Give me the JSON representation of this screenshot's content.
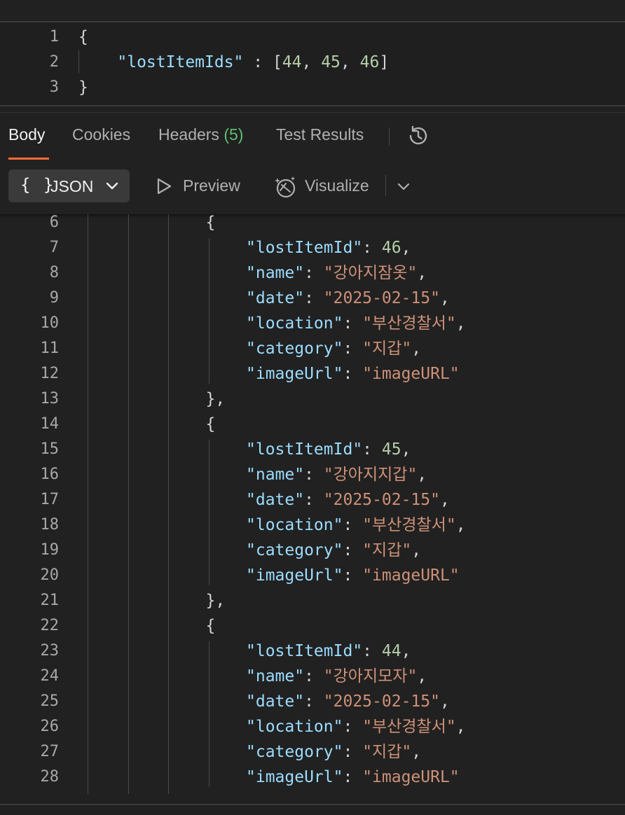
{
  "request": {
    "lines": [
      {
        "n": "1",
        "tokens": [
          {
            "t": "{",
            "c": "brace"
          }
        ]
      },
      {
        "n": "2",
        "tokens": [
          {
            "t": "    ",
            "c": "punc"
          },
          {
            "t": "\"lostItemIds\"",
            "c": "key"
          },
          {
            "t": " : [",
            "c": "punc"
          },
          {
            "t": "44",
            "c": "num"
          },
          {
            "t": ", ",
            "c": "punc"
          },
          {
            "t": "45",
            "c": "num"
          },
          {
            "t": ", ",
            "c": "punc"
          },
          {
            "t": "46",
            "c": "num"
          },
          {
            "t": "]",
            "c": "punc"
          }
        ]
      },
      {
        "n": "3",
        "tokens": [
          {
            "t": "}",
            "c": "brace"
          }
        ]
      }
    ]
  },
  "tabs": {
    "body": "Body",
    "cookies": "Cookies",
    "headers": "Headers",
    "headers_count": "(5)",
    "test_results": "Test Results",
    "history_icon": "history-icon"
  },
  "toolbar": {
    "format_braces": "{ }",
    "format_label": "JSON",
    "preview_label": "Preview",
    "visualize_label": "Visualize"
  },
  "colors": {
    "accent": "#ff6c37",
    "key": "#9cdcfe",
    "string": "#ce9178",
    "number": "#b5cea8",
    "count": "#5fbf73"
  },
  "response": {
    "lines": [
      {
        "n": "6",
        "indent": 3,
        "tokens": [
          {
            "t": "{",
            "c": "brace"
          }
        ]
      },
      {
        "n": "7",
        "indent": 4,
        "tokens": [
          {
            "t": "\"lostItemId\"",
            "c": "key"
          },
          {
            "t": ": ",
            "c": "punc"
          },
          {
            "t": "46",
            "c": "num"
          },
          {
            "t": ",",
            "c": "punc"
          }
        ]
      },
      {
        "n": "8",
        "indent": 4,
        "tokens": [
          {
            "t": "\"name\"",
            "c": "key"
          },
          {
            "t": ": ",
            "c": "punc"
          },
          {
            "t": "\"강아지잠옷\"",
            "c": "str"
          },
          {
            "t": ",",
            "c": "punc"
          }
        ]
      },
      {
        "n": "9",
        "indent": 4,
        "tokens": [
          {
            "t": "\"date\"",
            "c": "key"
          },
          {
            "t": ": ",
            "c": "punc"
          },
          {
            "t": "\"2025-02-15\"",
            "c": "str"
          },
          {
            "t": ",",
            "c": "punc"
          }
        ]
      },
      {
        "n": "10",
        "indent": 4,
        "tokens": [
          {
            "t": "\"location\"",
            "c": "key"
          },
          {
            "t": ": ",
            "c": "punc"
          },
          {
            "t": "\"부산경찰서\"",
            "c": "str"
          },
          {
            "t": ",",
            "c": "punc"
          }
        ]
      },
      {
        "n": "11",
        "indent": 4,
        "tokens": [
          {
            "t": "\"category\"",
            "c": "key"
          },
          {
            "t": ": ",
            "c": "punc"
          },
          {
            "t": "\"지갑\"",
            "c": "str"
          },
          {
            "t": ",",
            "c": "punc"
          }
        ]
      },
      {
        "n": "12",
        "indent": 4,
        "tokens": [
          {
            "t": "\"imageUrl\"",
            "c": "key"
          },
          {
            "t": ": ",
            "c": "punc"
          },
          {
            "t": "\"imageURL\"",
            "c": "str"
          }
        ]
      },
      {
        "n": "13",
        "indent": 3,
        "tokens": [
          {
            "t": "},",
            "c": "brace"
          }
        ]
      },
      {
        "n": "14",
        "indent": 3,
        "tokens": [
          {
            "t": "{",
            "c": "brace"
          }
        ]
      },
      {
        "n": "15",
        "indent": 4,
        "tokens": [
          {
            "t": "\"lostItemId\"",
            "c": "key"
          },
          {
            "t": ": ",
            "c": "punc"
          },
          {
            "t": "45",
            "c": "num"
          },
          {
            "t": ",",
            "c": "punc"
          }
        ]
      },
      {
        "n": "16",
        "indent": 4,
        "tokens": [
          {
            "t": "\"name\"",
            "c": "key"
          },
          {
            "t": ": ",
            "c": "punc"
          },
          {
            "t": "\"강아지지갑\"",
            "c": "str"
          },
          {
            "t": ",",
            "c": "punc"
          }
        ]
      },
      {
        "n": "17",
        "indent": 4,
        "tokens": [
          {
            "t": "\"date\"",
            "c": "key"
          },
          {
            "t": ": ",
            "c": "punc"
          },
          {
            "t": "\"2025-02-15\"",
            "c": "str"
          },
          {
            "t": ",",
            "c": "punc"
          }
        ]
      },
      {
        "n": "18",
        "indent": 4,
        "tokens": [
          {
            "t": "\"location\"",
            "c": "key"
          },
          {
            "t": ": ",
            "c": "punc"
          },
          {
            "t": "\"부산경찰서\"",
            "c": "str"
          },
          {
            "t": ",",
            "c": "punc"
          }
        ]
      },
      {
        "n": "19",
        "indent": 4,
        "tokens": [
          {
            "t": "\"category\"",
            "c": "key"
          },
          {
            "t": ": ",
            "c": "punc"
          },
          {
            "t": "\"지갑\"",
            "c": "str"
          },
          {
            "t": ",",
            "c": "punc"
          }
        ]
      },
      {
        "n": "20",
        "indent": 4,
        "tokens": [
          {
            "t": "\"imageUrl\"",
            "c": "key"
          },
          {
            "t": ": ",
            "c": "punc"
          },
          {
            "t": "\"imageURL\"",
            "c": "str"
          }
        ]
      },
      {
        "n": "21",
        "indent": 3,
        "tokens": [
          {
            "t": "},",
            "c": "brace"
          }
        ]
      },
      {
        "n": "22",
        "indent": 3,
        "tokens": [
          {
            "t": "{",
            "c": "brace"
          }
        ]
      },
      {
        "n": "23",
        "indent": 4,
        "tokens": [
          {
            "t": "\"lostItemId\"",
            "c": "key"
          },
          {
            "t": ": ",
            "c": "punc"
          },
          {
            "t": "44",
            "c": "num"
          },
          {
            "t": ",",
            "c": "punc"
          }
        ]
      },
      {
        "n": "24",
        "indent": 4,
        "tokens": [
          {
            "t": "\"name\"",
            "c": "key"
          },
          {
            "t": ": ",
            "c": "punc"
          },
          {
            "t": "\"강아지모자\"",
            "c": "str"
          },
          {
            "t": ",",
            "c": "punc"
          }
        ]
      },
      {
        "n": "25",
        "indent": 4,
        "tokens": [
          {
            "t": "\"date\"",
            "c": "key"
          },
          {
            "t": ": ",
            "c": "punc"
          },
          {
            "t": "\"2025-02-15\"",
            "c": "str"
          },
          {
            "t": ",",
            "c": "punc"
          }
        ]
      },
      {
        "n": "26",
        "indent": 4,
        "tokens": [
          {
            "t": "\"location\"",
            "c": "key"
          },
          {
            "t": ": ",
            "c": "punc"
          },
          {
            "t": "\"부산경찰서\"",
            "c": "str"
          },
          {
            "t": ",",
            "c": "punc"
          }
        ]
      },
      {
        "n": "27",
        "indent": 4,
        "tokens": [
          {
            "t": "\"category\"",
            "c": "key"
          },
          {
            "t": ": ",
            "c": "punc"
          },
          {
            "t": "\"지갑\"",
            "c": "str"
          },
          {
            "t": ",",
            "c": "punc"
          }
        ]
      },
      {
        "n": "28",
        "indent": 4,
        "tokens": [
          {
            "t": "\"imageUrl\"",
            "c": "key"
          },
          {
            "t": ": ",
            "c": "punc"
          },
          {
            "t": "\"imageURL\"",
            "c": "str"
          }
        ]
      }
    ]
  }
}
